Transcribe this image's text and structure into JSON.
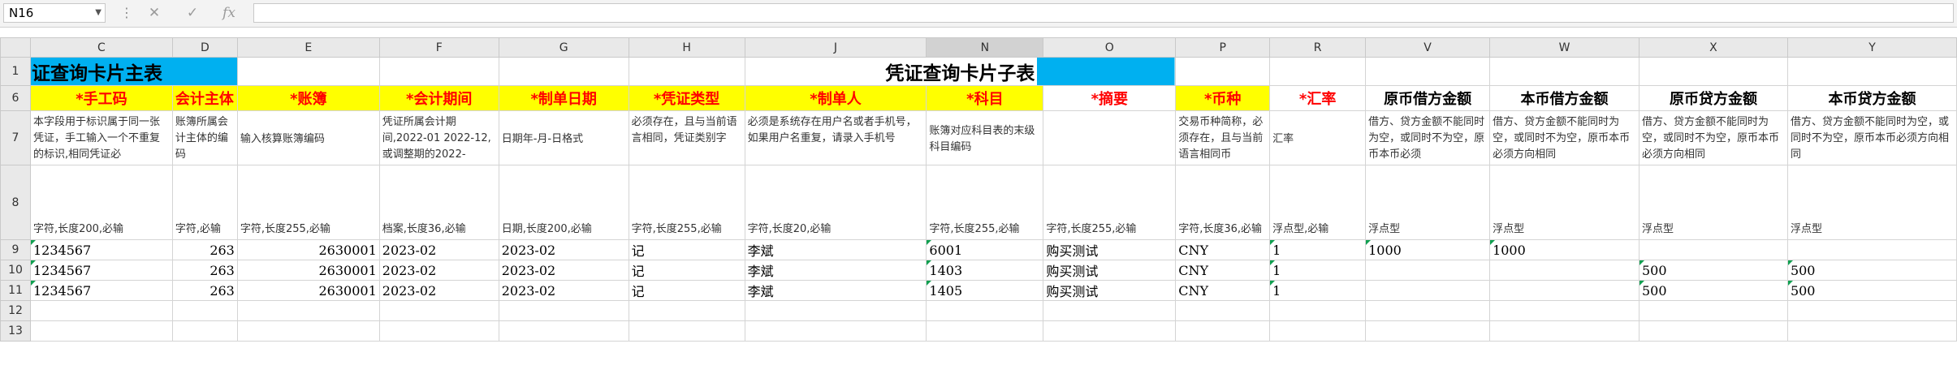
{
  "formula_bar": {
    "cell_ref": "N16",
    "cancel_glyph": "✕",
    "confirm_glyph": "✓",
    "function_glyph": "fx",
    "content": ""
  },
  "columns": [
    "C",
    "D",
    "E",
    "F",
    "G",
    "H",
    "J",
    "N",
    "O",
    "P",
    "R",
    "V",
    "W",
    "X",
    "Y"
  ],
  "selected_column": "N",
  "rows": [
    "1",
    "6",
    "7",
    "8",
    "9",
    "10",
    "11",
    "12",
    "13"
  ],
  "sheet": {
    "main_title": "证查询卡片主表",
    "sub_title": "凭证查询卡片子表",
    "headers": [
      "*手工码",
      "会计主体",
      "*账簿",
      "*会计期间",
      "*制单日期",
      "*凭证类型",
      "*制单人",
      "*科目",
      "*摘要",
      "*币种",
      "*汇率",
      "原币借方金额",
      "本币借方金额",
      "原币贷方金额",
      "本币贷方金额"
    ],
    "descriptions": [
      "本字段用于标识属于同一张凭证，手工输入一个不重复的标识,相同凭证必",
      "账簿所属会计主体的编码",
      "输入核算账簿编码",
      "凭证所属会计期间,2022-01 2022-12,或调整期的2022-",
      "日期年-月-日格式",
      "必须存在，且与当前语言相同，凭证类别字",
      "必须是系统存在用户名或者手机号，如果用户名重复，请录入手机号",
      "账簿对应科目表的末级科目编码",
      "",
      "交易币种简称，必须存在，且与当前语言相同币",
      "汇率",
      "借方、贷方金额不能同时为空，或同时不为空，原币本币必须",
      "借方、贷方金额不能同时为空，或同时不为空，原币本币必须方向相同",
      "借方、贷方金额不能同时为空，或同时不为空，原币本币必须方向相同",
      "借方、贷方金额不能同时为空，或同时不为空，原币本币必须方向相同"
    ],
    "formats": [
      "字符,长度200,必输",
      "字符,必输",
      "字符,长度255,必输",
      "档案,长度36,必输",
      "日期,长度200,必输",
      "字符,长度255,必输",
      "字符,长度20,必输",
      "字符,长度255,必输",
      "字符,长度255,必输",
      "字符,长度36,必输",
      "浮点型,必输",
      "浮点型",
      "浮点型",
      "浮点型",
      "浮点型"
    ],
    "data_rows": [
      [
        "1234567",
        "263",
        "2630001",
        "2023-02",
        "2023-02",
        "记",
        "李斌",
        "6001",
        "购买测试",
        "CNY",
        "1",
        "1000",
        "1000",
        "",
        ""
      ],
      [
        "1234567",
        "263",
        "2630001",
        "2023-02",
        "2023-02",
        "记",
        "李斌",
        "1403",
        "购买测试",
        "CNY",
        "1",
        "",
        "",
        "500",
        "500"
      ],
      [
        "1234567",
        "263",
        "2630001",
        "2023-02",
        "2023-02",
        "记",
        "李斌",
        "1405",
        "购买测试",
        "CNY",
        "1",
        "",
        "",
        "500",
        "500"
      ]
    ]
  }
}
